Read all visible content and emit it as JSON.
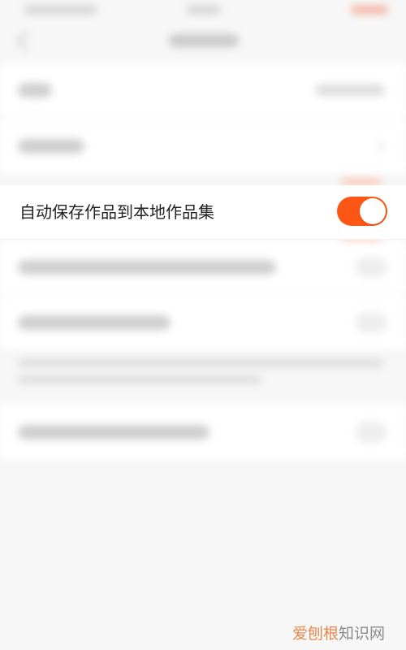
{
  "setting": {
    "label": "自动保存作品到本地作品集",
    "enabled": true
  },
  "watermark": {
    "brand": "爱刨根",
    "rest": "知识网"
  },
  "colors": {
    "accent": "#fe5614",
    "background": "#f7f7f7",
    "row_background": "#ffffff",
    "label_text": "#222222"
  },
  "icons": {
    "back": "chevron-left-icon",
    "row_arrow": "chevron-right-icon"
  }
}
